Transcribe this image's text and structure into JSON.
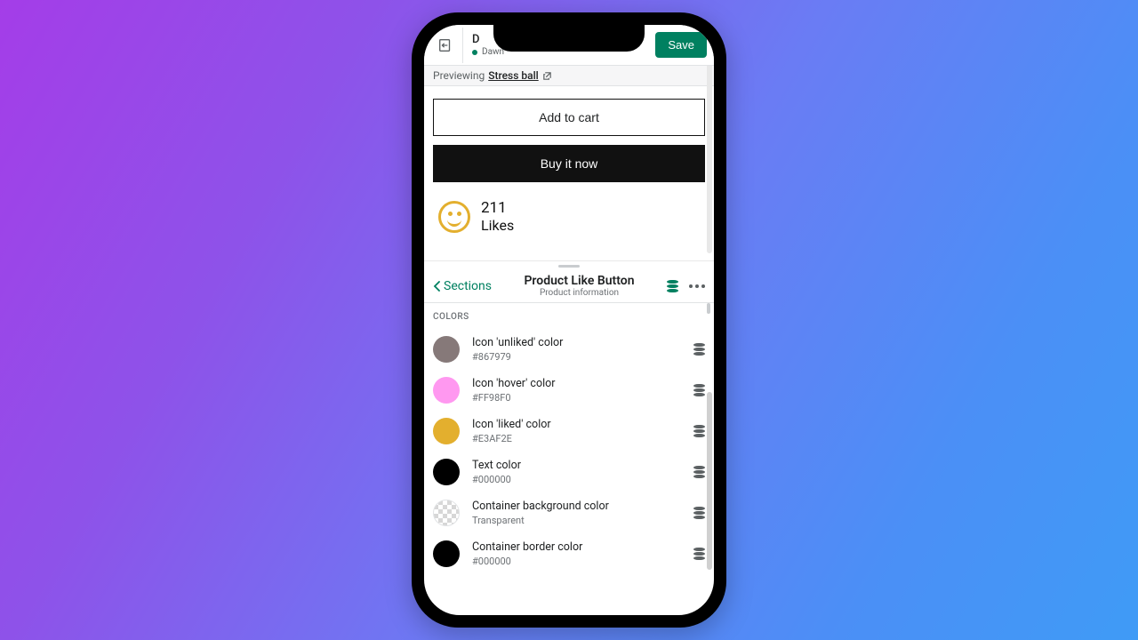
{
  "header": {
    "themeTitle": "D",
    "themeSubtitle": "Dawn",
    "save": "Save"
  },
  "previewBar": {
    "label": "Previewing",
    "product": "Stress ball"
  },
  "preview": {
    "addToCart": "Add to cart",
    "buyNow": "Buy it now",
    "likesCount": "211",
    "likesLabel": "Likes"
  },
  "panel": {
    "back": "Sections",
    "title": "Product Like Button",
    "subtitle": "Product information"
  },
  "colorsLabel": "COLORS",
  "colors": [
    {
      "name": "Icon 'unliked' color",
      "hex": "#867979",
      "swatch": "#867979"
    },
    {
      "name": "Icon 'hover' color",
      "hex": "#FF98F0",
      "swatch": "#FF98F0"
    },
    {
      "name": "Icon 'liked' color",
      "hex": "#E3AF2E",
      "swatch": "#E3AF2E"
    },
    {
      "name": "Text color",
      "hex": "#000000",
      "swatch": "#000000"
    },
    {
      "name": "Container background color",
      "hex": "Transparent",
      "swatch": "transparent"
    },
    {
      "name": "Container border color",
      "hex": "#000000",
      "swatch": "#000000"
    }
  ]
}
